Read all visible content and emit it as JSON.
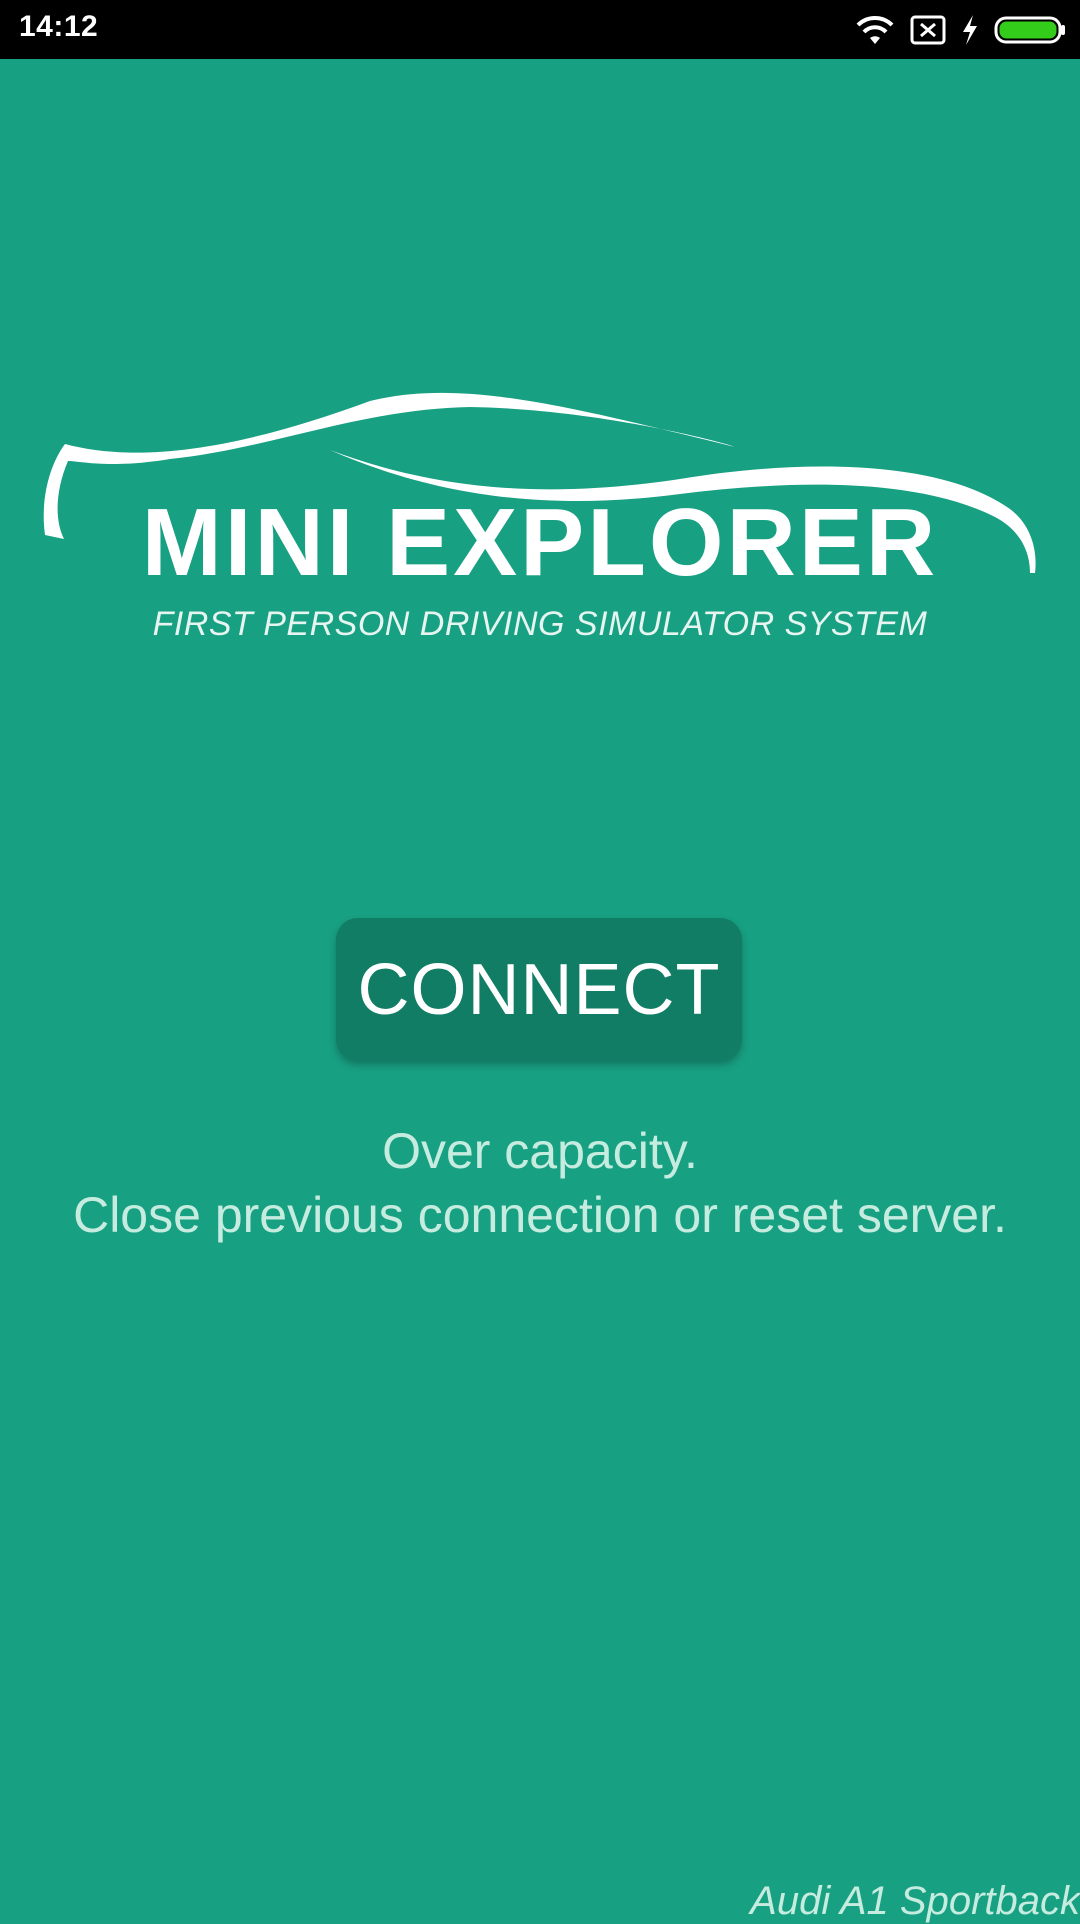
{
  "status_bar": {
    "time": "14:12",
    "icons": [
      "wifi-icon",
      "sim-x-icon",
      "charging-icon",
      "battery-icon"
    ],
    "battery_color": "#33cc1a"
  },
  "logo": {
    "title": "MINI EXPLORER",
    "subtitle": "FIRST PERSON DRIVING SIMULATOR SYSTEM",
    "icon": "car-silhouette-icon"
  },
  "connect_button": {
    "label": "CONNECT"
  },
  "message": {
    "line1": "Over capacity.",
    "line2": "Close previous connection or reset server."
  },
  "footer": {
    "note": "Audi A1 Sportback"
  },
  "colors": {
    "background": "#18a083",
    "button": "#117d65",
    "message_text": "#c5ecdf"
  }
}
